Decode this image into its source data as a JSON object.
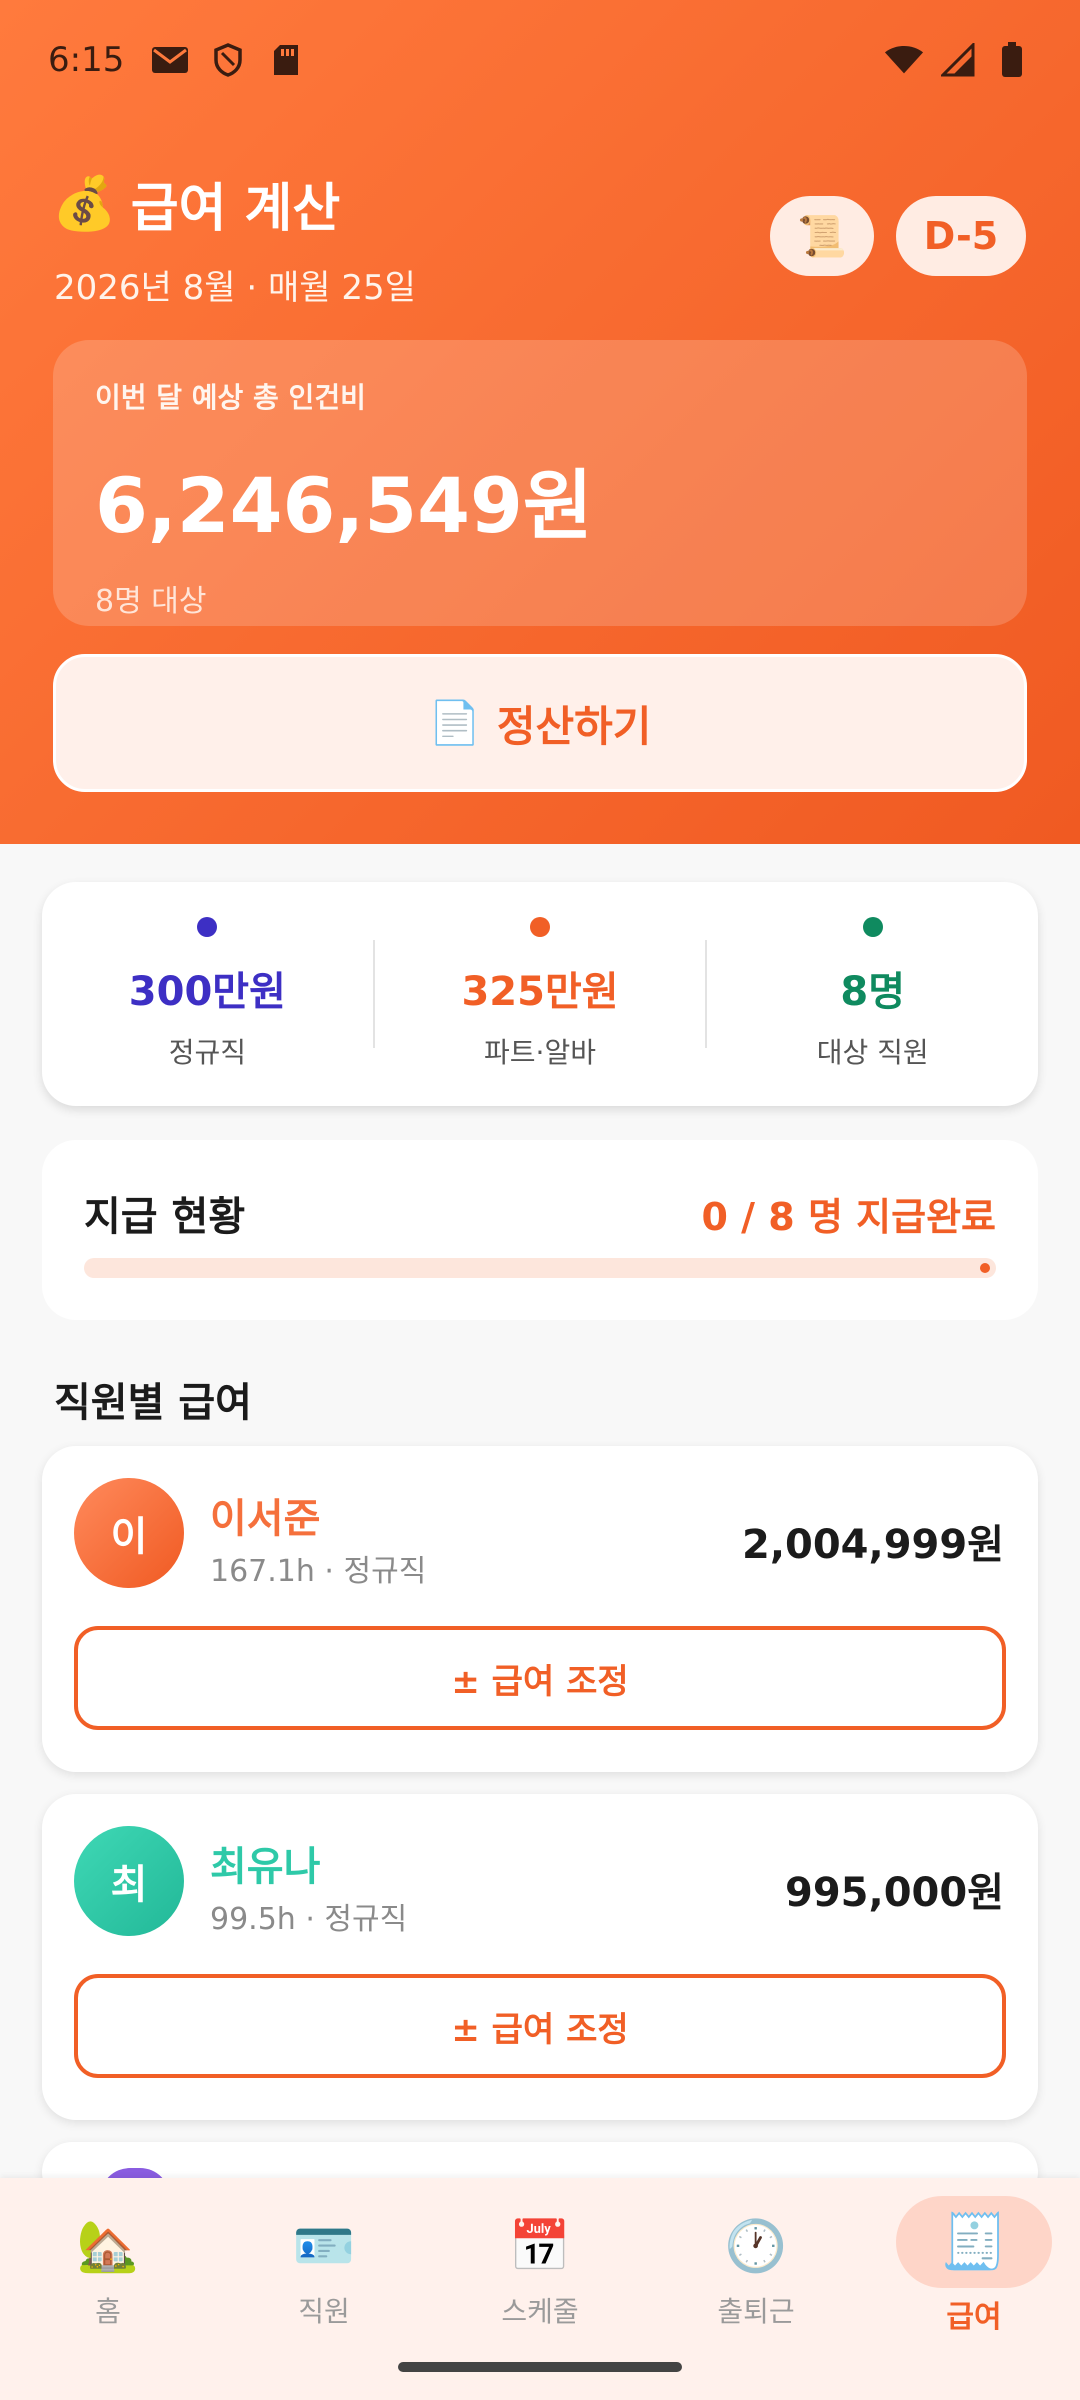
{
  "status_bar": {
    "time": "6:15"
  },
  "header": {
    "title_emoji": "💰",
    "title": "급여 계산",
    "subtitle": "2026년 8월 · 매월 25일",
    "scroll_icon": "📜",
    "dday": "D-5"
  },
  "total": {
    "label": "이번 달 예상 총 인건비",
    "amount": "6,246,549원",
    "sub": "8명 대상"
  },
  "settle_button": {
    "icon": "📄",
    "label": "정산하기"
  },
  "stats": [
    {
      "value": "300만원",
      "label": "정규직",
      "color": "#3d2fc4"
    },
    {
      "value": "325만원",
      "label": "파트·알바",
      "color": "#f15f26"
    },
    {
      "value": "8명",
      "label": "대상 직원",
      "color": "#0f8a5f"
    }
  ],
  "payment_status": {
    "title": "지급 현황",
    "status": "0 / 8 명 지급완료",
    "paid": 0,
    "total": 8
  },
  "section_title": "직원별 급여",
  "employees": [
    {
      "initial": "이",
      "name": "이서준",
      "meta": "167.1h · 정규직",
      "salary": "2,004,999원",
      "color": "#ff6b3d",
      "adjust_label": "± 급여 조정"
    },
    {
      "initial": "최",
      "name": "최유나",
      "meta": "99.5h · 정규직",
      "salary": "995,000원",
      "color": "#2ec9a8",
      "adjust_label": "± 급여 조정"
    }
  ],
  "nav": [
    {
      "icon": "🏡",
      "label": "홈"
    },
    {
      "icon": "🪪",
      "label": "직원"
    },
    {
      "icon": "📅",
      "label": "스케줄"
    },
    {
      "icon": "🕐",
      "label": "출퇴근"
    },
    {
      "icon": "🧾",
      "label": "급여",
      "active": true
    }
  ]
}
